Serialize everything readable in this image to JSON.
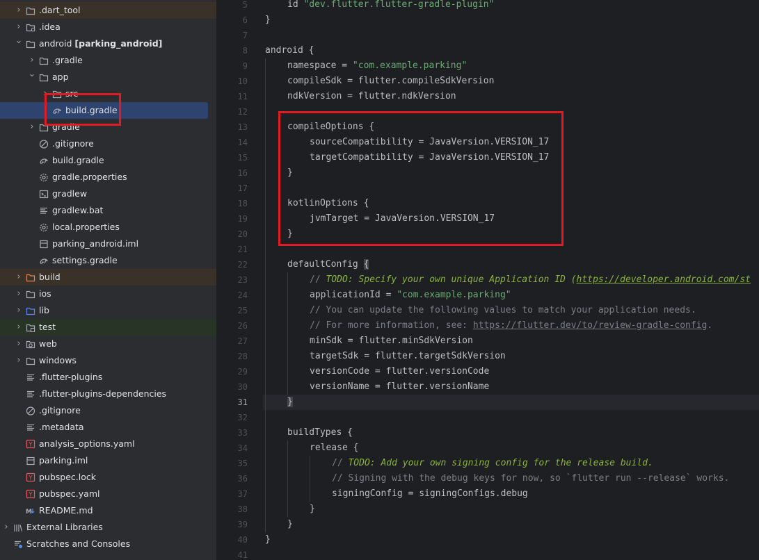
{
  "project_tree": [
    {
      "label": ".dart_tool",
      "depth": 1,
      "chevron": "closed",
      "icon": "folder-icon",
      "bg": "orange"
    },
    {
      "label": ".idea",
      "depth": 1,
      "chevron": "closed",
      "icon": "folder-settings-icon"
    },
    {
      "label": "android",
      "bold": "[parking_android]",
      "depth": 1,
      "chevron": "open",
      "icon": "folder-icon"
    },
    {
      "label": ".gradle",
      "depth": 2,
      "chevron": "closed",
      "icon": "folder-icon"
    },
    {
      "label": "app",
      "depth": 2,
      "chevron": "open",
      "icon": "folder-icon"
    },
    {
      "label": "src",
      "depth": 3,
      "chevron": "closed",
      "icon": "folder-icon"
    },
    {
      "label": "build.gradle",
      "depth": 3,
      "chevron": "none",
      "icon": "gradle-icon",
      "selected": true
    },
    {
      "label": "gradle",
      "depth": 2,
      "chevron": "closed",
      "icon": "folder-icon"
    },
    {
      "label": ".gitignore",
      "depth": 2,
      "chevron": "none",
      "icon": "ignore-icon"
    },
    {
      "label": "build.gradle",
      "depth": 2,
      "chevron": "none",
      "icon": "gradle-icon"
    },
    {
      "label": "gradle.properties",
      "depth": 2,
      "chevron": "none",
      "icon": "gear-icon"
    },
    {
      "label": "gradlew",
      "depth": 2,
      "chevron": "none",
      "icon": "terminal-icon"
    },
    {
      "label": "gradlew.bat",
      "depth": 2,
      "chevron": "none",
      "icon": "text-file-icon"
    },
    {
      "label": "local.properties",
      "depth": 2,
      "chevron": "none",
      "icon": "gear-icon"
    },
    {
      "label": "parking_android.iml",
      "depth": 2,
      "chevron": "none",
      "icon": "module-file-icon"
    },
    {
      "label": "settings.gradle",
      "depth": 2,
      "chevron": "none",
      "icon": "gradle-icon"
    },
    {
      "label": "build",
      "depth": 1,
      "chevron": "closed",
      "icon": "folder-excluded-icon",
      "bg": "orange"
    },
    {
      "label": "ios",
      "depth": 1,
      "chevron": "closed",
      "icon": "folder-icon"
    },
    {
      "label": "lib",
      "depth": 1,
      "chevron": "closed",
      "icon": "folder-source-icon"
    },
    {
      "label": "test",
      "depth": 1,
      "chevron": "closed",
      "icon": "folder-test-icon",
      "bg": "green"
    },
    {
      "label": "web",
      "depth": 1,
      "chevron": "closed",
      "icon": "folder-web-icon"
    },
    {
      "label": "windows",
      "depth": 1,
      "chevron": "closed",
      "icon": "folder-icon"
    },
    {
      "label": ".flutter-plugins",
      "depth": 1,
      "chevron": "none",
      "icon": "text-file-icon"
    },
    {
      "label": ".flutter-plugins-dependencies",
      "depth": 1,
      "chevron": "none",
      "icon": "text-file-icon"
    },
    {
      "label": ".gitignore",
      "depth": 1,
      "chevron": "none",
      "icon": "ignore-icon"
    },
    {
      "label": ".metadata",
      "depth": 1,
      "chevron": "none",
      "icon": "text-file-icon"
    },
    {
      "label": "analysis_options.yaml",
      "depth": 1,
      "chevron": "none",
      "icon": "yaml-icon"
    },
    {
      "label": "parking.iml",
      "depth": 1,
      "chevron": "none",
      "icon": "module-file-icon"
    },
    {
      "label": "pubspec.lock",
      "depth": 1,
      "chevron": "none",
      "icon": "yaml-icon"
    },
    {
      "label": "pubspec.yaml",
      "depth": 1,
      "chevron": "none",
      "icon": "yaml-icon"
    },
    {
      "label": "README.md",
      "depth": 1,
      "chevron": "none",
      "icon": "markdown-icon"
    },
    {
      "label": "External Libraries",
      "depth": 0,
      "chevron": "closed",
      "icon": "library-icon"
    },
    {
      "label": "Scratches and Consoles",
      "depth": 0,
      "chevron": "none",
      "icon": "scratches-icon"
    }
  ],
  "editor": {
    "current_line": 31,
    "lines": [
      {
        "n": 5,
        "indent": 1,
        "parts": [
          [
            "id ",
            ""
          ],
          [
            "\"dev.flutter.flutter-gradle-plugin\"",
            "s"
          ]
        ]
      },
      {
        "n": 6,
        "indent": 0,
        "parts": [
          [
            "}",
            ""
          ]
        ]
      },
      {
        "n": 7,
        "indent": 0,
        "parts": []
      },
      {
        "n": 8,
        "indent": 0,
        "parts": [
          [
            "android {",
            ""
          ]
        ]
      },
      {
        "n": 9,
        "indent": 1,
        "parts": [
          [
            "namespace = ",
            ""
          ],
          [
            "\"com.example.parking\"",
            "s"
          ]
        ]
      },
      {
        "n": 10,
        "indent": 1,
        "parts": [
          [
            "compileSdk = flutter.compileSdkVersion",
            ""
          ]
        ]
      },
      {
        "n": 11,
        "indent": 1,
        "parts": [
          [
            "ndkVersion = flutter.ndkVersion",
            ""
          ]
        ]
      },
      {
        "n": 12,
        "indent": 0,
        "parts": []
      },
      {
        "n": 13,
        "indent": 1,
        "parts": [
          [
            "compileOptions {",
            ""
          ]
        ]
      },
      {
        "n": 14,
        "indent": 2,
        "parts": [
          [
            "sourceCompatibility = JavaVersion.VERSION_17",
            ""
          ]
        ]
      },
      {
        "n": 15,
        "indent": 2,
        "parts": [
          [
            "targetCompatibility = JavaVersion.VERSION_17",
            ""
          ]
        ]
      },
      {
        "n": 16,
        "indent": 1,
        "parts": [
          [
            "}",
            ""
          ]
        ]
      },
      {
        "n": 17,
        "indent": 0,
        "parts": []
      },
      {
        "n": 18,
        "indent": 1,
        "parts": [
          [
            "kotlinOptions {",
            ""
          ]
        ]
      },
      {
        "n": 19,
        "indent": 2,
        "parts": [
          [
            "jvmTarget = JavaVersion.VERSION_17",
            ""
          ]
        ]
      },
      {
        "n": 20,
        "indent": 1,
        "parts": [
          [
            "}",
            ""
          ]
        ]
      },
      {
        "n": 21,
        "indent": 0,
        "parts": []
      },
      {
        "n": 22,
        "indent": 1,
        "parts": [
          [
            "defaultConfig ",
            ""
          ],
          [
            "{",
            "brace-hl"
          ]
        ]
      },
      {
        "n": 23,
        "indent": 2,
        "parts": [
          [
            "// ",
            "c"
          ],
          [
            "TODO: Specify your own unique Application ID (",
            "todo"
          ],
          [
            "https://developer.android.com/st",
            "todo link"
          ]
        ]
      },
      {
        "n": 24,
        "indent": 2,
        "parts": [
          [
            "applicationId = ",
            ""
          ],
          [
            "\"com.example.parking\"",
            "s"
          ]
        ]
      },
      {
        "n": 25,
        "indent": 2,
        "parts": [
          [
            "// You can update the following values to match your application needs.",
            "c"
          ]
        ]
      },
      {
        "n": 26,
        "indent": 2,
        "parts": [
          [
            "// For more information, see: ",
            "c"
          ],
          [
            "https://flutter.dev/to/review-gradle-config",
            "c link"
          ],
          [
            ".",
            "c"
          ]
        ]
      },
      {
        "n": 27,
        "indent": 2,
        "parts": [
          [
            "minSdk = flutter.minSdkVersion",
            ""
          ]
        ]
      },
      {
        "n": 28,
        "indent": 2,
        "parts": [
          [
            "targetSdk = flutter.targetSdkVersion",
            ""
          ]
        ]
      },
      {
        "n": 29,
        "indent": 2,
        "parts": [
          [
            "versionCode = flutter.versionCode",
            ""
          ]
        ]
      },
      {
        "n": 30,
        "indent": 2,
        "parts": [
          [
            "versionName = flutter.versionName",
            ""
          ]
        ]
      },
      {
        "n": 31,
        "indent": 1,
        "parts": [
          [
            "}",
            "brace-hl"
          ]
        ]
      },
      {
        "n": 32,
        "indent": 0,
        "parts": []
      },
      {
        "n": 33,
        "indent": 1,
        "parts": [
          [
            "buildTypes {",
            ""
          ]
        ]
      },
      {
        "n": 34,
        "indent": 2,
        "parts": [
          [
            "release {",
            ""
          ]
        ]
      },
      {
        "n": 35,
        "indent": 3,
        "parts": [
          [
            "// ",
            "c"
          ],
          [
            "TODO: Add your own signing config for the release build.",
            "todo"
          ]
        ]
      },
      {
        "n": 36,
        "indent": 3,
        "parts": [
          [
            "// Signing with the debug keys for now, so `flutter run --release` works.",
            "c"
          ]
        ]
      },
      {
        "n": 37,
        "indent": 3,
        "parts": [
          [
            "signingConfig = signingConfigs.debug",
            ""
          ]
        ]
      },
      {
        "n": 38,
        "indent": 2,
        "parts": [
          [
            "}",
            ""
          ]
        ]
      },
      {
        "n": 39,
        "indent": 1,
        "parts": [
          [
            "}",
            ""
          ]
        ]
      },
      {
        "n": 40,
        "indent": 0,
        "parts": [
          [
            "}",
            ""
          ]
        ]
      },
      {
        "n": 41,
        "indent": 0,
        "parts": []
      }
    ]
  }
}
